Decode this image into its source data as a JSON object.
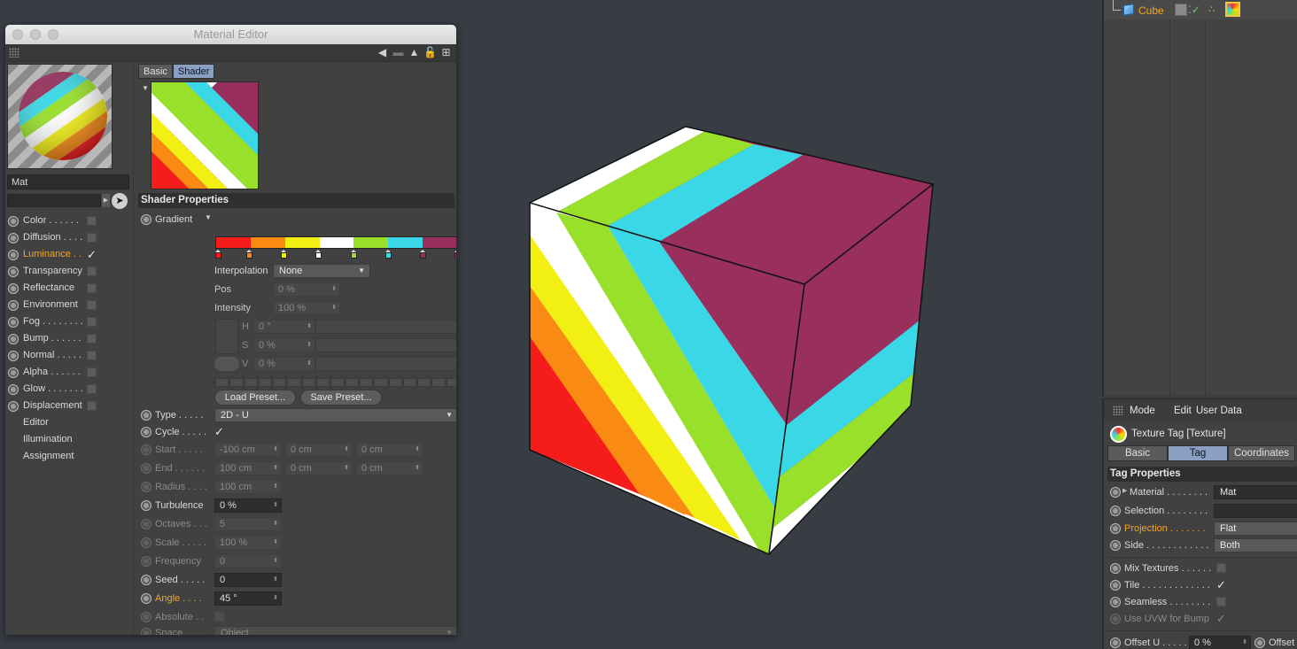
{
  "window": {
    "title": "Material Editor"
  },
  "material": {
    "name": "Mat"
  },
  "channels": [
    {
      "label": "Color . . . . . .",
      "checked": false,
      "active": false
    },
    {
      "label": "Diffusion . . . .",
      "checked": false,
      "active": false
    },
    {
      "label": "Luminance . .",
      "checked": true,
      "active": true
    },
    {
      "label": "Transparency",
      "checked": false,
      "active": false
    },
    {
      "label": "Reflectance",
      "checked": false,
      "active": false
    },
    {
      "label": "Environment",
      "checked": false,
      "active": false
    },
    {
      "label": "Fog . . . . . . . .",
      "checked": false,
      "active": false
    },
    {
      "label": "Bump . . . . . .",
      "checked": false,
      "active": false
    },
    {
      "label": "Normal . . . . .",
      "checked": false,
      "active": false
    },
    {
      "label": "Alpha . . . . . .",
      "checked": false,
      "active": false
    },
    {
      "label": "Glow . . . . . . .",
      "checked": false,
      "active": false
    },
    {
      "label": "Displacement",
      "checked": false,
      "active": false
    }
  ],
  "extra_items": [
    "Editor",
    "Illumination",
    "Assignment"
  ],
  "editor_tabs": [
    "Basic",
    "Shader"
  ],
  "shader": {
    "section_title": "Shader Properties",
    "gradient_label": "Gradient",
    "gradient_colors": [
      "#f51c1c",
      "#f98a12",
      "#f2ef12",
      "#ffffff",
      "#98e02a",
      "#3ad8e6",
      "#982f5c"
    ],
    "interpolation_label": "Interpolation",
    "interpolation_value": "None",
    "pos_label": "Pos",
    "pos_value": "0 %",
    "intensity_label": "Intensity",
    "intensity_value": "100 %",
    "h_label": "H",
    "h_value": "0 °",
    "s_label": "S",
    "s_value": "0 %",
    "v_label": "V",
    "v_value": "0 %",
    "load_preset": "Load Preset...",
    "save_preset": "Save Preset...",
    "type_label": "Type . . . . .",
    "type_value": "2D - U",
    "cycle_label": "Cycle . . . . .",
    "start_label": "Start . . . . .",
    "start_values": [
      "-100 cm",
      "0 cm",
      "0 cm"
    ],
    "end_label": "End . . . . . .",
    "end_values": [
      "100 cm",
      "0 cm",
      "0 cm"
    ],
    "radius_label": "Radius . . . .",
    "radius_value": "100 cm",
    "turbulence_label": "Turbulence",
    "turbulence_value": "0 %",
    "octaves_label": "Octaves . . .",
    "octaves_value": "5",
    "scale_label": "Scale . . . . .",
    "scale_value": "100 %",
    "frequency_label": "Frequency",
    "frequency_value": "0",
    "seed_label": "Seed . . . . .",
    "seed_value": "0",
    "angle_label": "Angle . . . .",
    "angle_value": "45 °",
    "absolute_label": "Absolute . .",
    "space_label": "Space . . . .",
    "space_value": "Object"
  },
  "object_manager": {
    "object_name": "Cube"
  },
  "attributes": {
    "menu": [
      "Mode",
      "Edit",
      "User Data"
    ],
    "title": "Texture Tag [Texture]",
    "tabs": [
      "Basic",
      "Tag",
      "Coordinates"
    ],
    "section_title": "Tag Properties",
    "material_label": "Material . . . . . . . .",
    "material_value": "Mat",
    "selection_label": "Selection . . . . . . . .",
    "projection_label": "Projection . . . . . . .",
    "projection_value": "Flat",
    "side_label": "Side . . . . . . . . . . . .",
    "side_value": "Both",
    "mix_label": "Mix Textures . . . . . .",
    "tile_label": "Tile . . . . . . . . . . . . .",
    "seamless_label": "Seamless . . . . . . . .",
    "uvw_label": "Use UVW for Bump",
    "offset_u_label": "Offset U . . . . .",
    "offset_u_value": "0 %",
    "offset_v_label": "Offset"
  },
  "colors": {
    "accent": "#f5a623",
    "tab_selected": "#8aa0c2",
    "cube_top": "#982f5c"
  }
}
